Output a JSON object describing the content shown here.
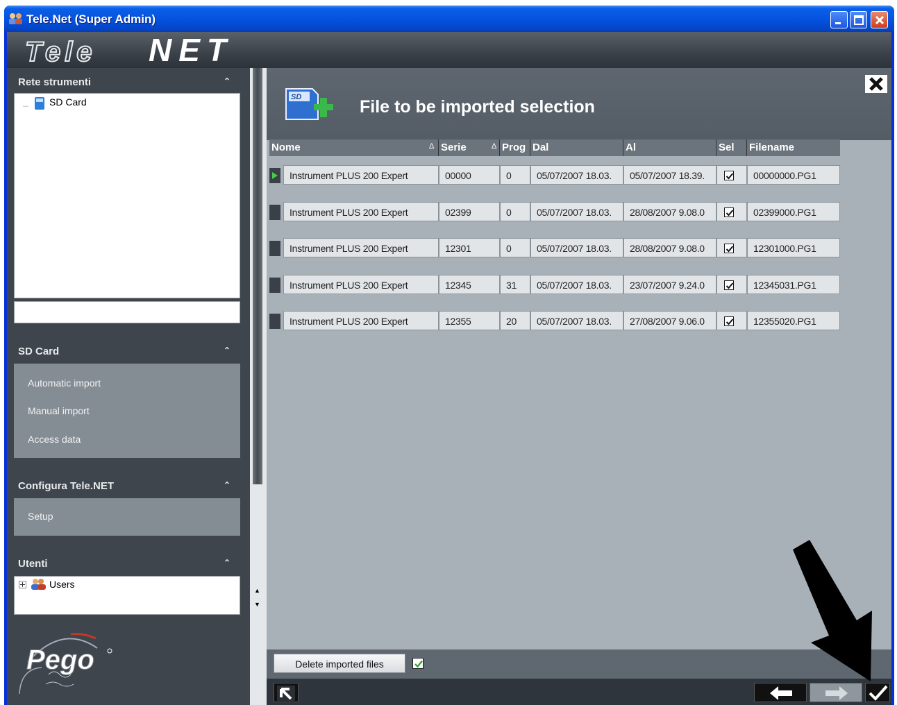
{
  "window": {
    "title": "Tele.Net (Super Admin)",
    "logo_text": "TeleNET"
  },
  "sidebar": {
    "network": {
      "header": "Rete strumenti",
      "tree_items": [
        "SD Card"
      ]
    },
    "sdcard": {
      "header": "SD Card",
      "items": [
        "Automatic import",
        "Manual import",
        "Access data"
      ]
    },
    "config": {
      "header": "Configura Tele.NET",
      "items": [
        "Setup"
      ]
    },
    "users": {
      "header": "Utenti",
      "tree_items": [
        "Users"
      ]
    },
    "brand_logo": "Pego"
  },
  "main": {
    "title": "File to be imported selection",
    "columns": [
      "Nome",
      "Serie",
      "Prog",
      "Dal",
      "Al",
      "Sel",
      "Filename"
    ],
    "rows": [
      {
        "nome": "Instrument PLUS 200 Expert",
        "serie": "00000",
        "prog": "0",
        "dal": "05/07/2007 18.03.",
        "al": "05/07/2007 18.39.",
        "sel": true,
        "filename": "00000000.PG1"
      },
      {
        "nome": "Instrument PLUS 200 Expert",
        "serie": "02399",
        "prog": "0",
        "dal": "05/07/2007 18.03.",
        "al": "28/08/2007 9.08.0",
        "sel": true,
        "filename": "02399000.PG1"
      },
      {
        "nome": "Instrument PLUS 200 Expert",
        "serie": "12301",
        "prog": "0",
        "dal": "05/07/2007 18.03.",
        "al": "28/08/2007 9.08.0",
        "sel": true,
        "filename": "12301000.PG1"
      },
      {
        "nome": "Instrument PLUS 200 Expert",
        "serie": "12345",
        "prog": "31",
        "dal": "05/07/2007 18.03.",
        "al": "23/07/2007 9.24.0",
        "sel": true,
        "filename": "12345031.PG1"
      },
      {
        "nome": "Instrument PLUS 200 Expert",
        "serie": "12355",
        "prog": "20",
        "dal": "05/07/2007 18.03.",
        "al": "27/08/2007 9.06.0",
        "sel": true,
        "filename": "12355020.PG1"
      }
    ],
    "delete_imported_label": "Delete imported files",
    "delete_imported_checked": true
  },
  "colors": {
    "titlebar": "#0553e0",
    "panel_dark": "#3e454c",
    "main_bg": "#a9b1b8",
    "check_green": "#2e9a2e"
  }
}
